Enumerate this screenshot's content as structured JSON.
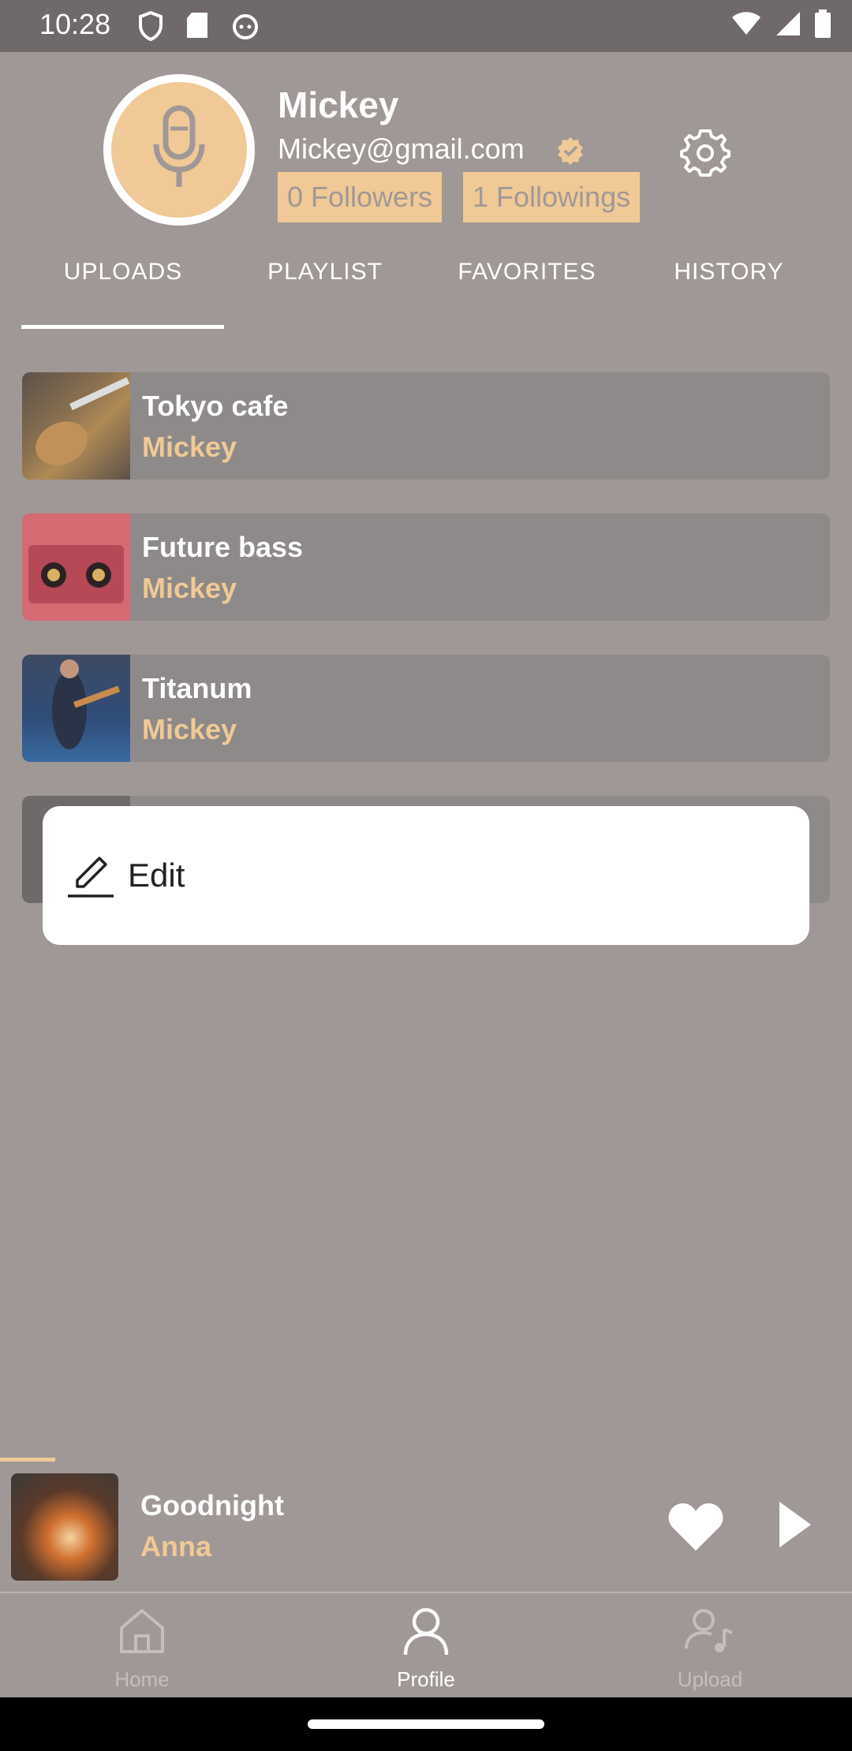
{
  "status_bar": {
    "time": "10:28",
    "left_icons": [
      "shield-icon",
      "sd-card-icon",
      "cat-face-icon"
    ],
    "right_icons": [
      "wifi-icon",
      "signal-icon",
      "battery-icon"
    ]
  },
  "profile": {
    "name": "Mickey",
    "email": "Mickey@gmail.com",
    "followers": "0 Followers",
    "followings": "1 Followings",
    "avatar_icon": "microphone-icon",
    "verified_icon": "verified-badge-icon",
    "settings_icon": "gear-icon"
  },
  "tabs": {
    "items": [
      {
        "label": "UPLOADS",
        "active": true
      },
      {
        "label": "PLAYLIST",
        "active": false
      },
      {
        "label": "FAVORITES",
        "active": false
      },
      {
        "label": "HISTORY",
        "active": false
      }
    ]
  },
  "tracks": [
    {
      "title": "Tokyo cafe",
      "artist": "Mickey"
    },
    {
      "title": "Future bass",
      "artist": "Mickey"
    },
    {
      "title": "Titanum",
      "artist": "Mickey"
    }
  ],
  "popup_menu": {
    "edit_label": "Edit",
    "edit_icon": "pencil-icon"
  },
  "now_playing": {
    "title": "Goodnight",
    "artist": "Anna",
    "heart_icon": "heart-icon",
    "play_icon": "play-icon"
  },
  "bottom_nav": {
    "items": [
      {
        "label": "Home",
        "icon": "home-icon",
        "active": false
      },
      {
        "label": "Profile",
        "icon": "person-icon",
        "active": true
      },
      {
        "label": "Upload",
        "icon": "upload-user-icon",
        "active": false
      }
    ]
  },
  "colors": {
    "accent": "#f0c996",
    "overlay_background": "#a09896",
    "card_background": "#8e8a89"
  }
}
